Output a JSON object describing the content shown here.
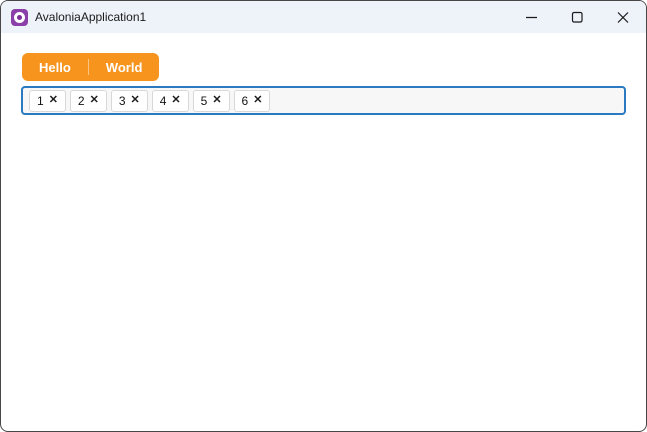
{
  "window": {
    "title": "AvaloniaApplication1"
  },
  "tabs": [
    {
      "label": "Hello"
    },
    {
      "label": "World"
    }
  ],
  "chips": {
    "close_glyph": "✕",
    "items": [
      {
        "label": "1"
      },
      {
        "label": "2"
      },
      {
        "label": "3"
      },
      {
        "label": "4"
      },
      {
        "label": "5"
      },
      {
        "label": "6"
      }
    ]
  },
  "colors": {
    "accent_orange": "#f7941d",
    "focus_border_blue": "#2a79c1",
    "titlebar_bg": "#eef2f9",
    "logo_purple": "#8b3fa8"
  }
}
